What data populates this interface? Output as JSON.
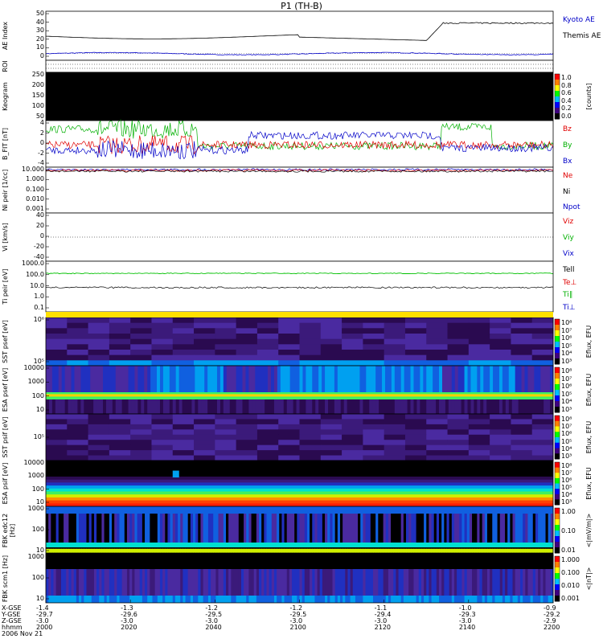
{
  "title": "P1 (TH-B)",
  "panels": [
    {
      "id": "ae",
      "ylabel": "AE Index",
      "ticks": [
        "50",
        "40",
        "30",
        "20",
        "10",
        "0"
      ],
      "legend": [
        {
          "text": "Kyoto AE",
          "color": "#0000c8"
        },
        {
          "text": "Themis AE",
          "color": "#000000"
        }
      ]
    },
    {
      "id": "roi",
      "ylabel": "ROI",
      "ticks": [],
      "legend": []
    },
    {
      "id": "keo",
      "ylabel": "Keogram",
      "ticks": [
        "250",
        "200",
        "150",
        "100",
        "50"
      ],
      "legend": [],
      "colorbar": {
        "ticks": [
          "1.0",
          "0.8",
          "0.6",
          "0.4",
          "0.2",
          "0.0"
        ],
        "label": "[counts]"
      }
    },
    {
      "id": "bfit",
      "ylabel": "B_FIT [nT]",
      "ticks": [
        "4",
        "2",
        "0",
        "-2",
        "-4"
      ],
      "legend": [
        {
          "text": "Bz",
          "color": "#e00000"
        },
        {
          "text": "By",
          "color": "#00b000"
        },
        {
          "text": "Bx",
          "color": "#0000c8"
        }
      ]
    },
    {
      "id": "ni",
      "ylabel": "Ni peir [1/cc]",
      "ticks": [
        "10.000",
        "1.000",
        "0.100",
        "0.010",
        "0.001"
      ],
      "legend": [
        {
          "text": "Ne",
          "color": "#e00000"
        },
        {
          "text": "Ni",
          "color": "#000000"
        },
        {
          "text": "Npot",
          "color": "#0000c8"
        }
      ]
    },
    {
      "id": "vi",
      "ylabel": "Vi [km/s]",
      "ticks": [
        "40",
        "20",
        "0",
        "-20",
        "-40"
      ],
      "legend": [
        {
          "text": "Viz",
          "color": "#e00000"
        },
        {
          "text": "Viy",
          "color": "#00b000"
        },
        {
          "text": "Vix",
          "color": "#0000c8"
        }
      ]
    },
    {
      "id": "ti",
      "ylabel": "Ti peir [eV]",
      "ticks": [
        "1000.0",
        "100.0",
        "10.0",
        "1.0",
        "0.1"
      ],
      "legend": [
        {
          "text": "Tell",
          "color": "#000000"
        },
        {
          "text": "Te⊥",
          "color": "#e00000"
        },
        {
          "text": "Ti∥",
          "color": "#00b000"
        },
        {
          "text": "Ti⊥",
          "color": "#0000c8"
        }
      ]
    },
    {
      "id": "sst_e",
      "ylabel": "SST psef [eV]",
      "ticks": [
        "10⁶",
        "10⁵"
      ],
      "legend": [],
      "colorbar": {
        "ticks": [
          "10⁸",
          "10⁷",
          "10⁶",
          "10⁵",
          "10⁴",
          "10³"
        ],
        "label": "Eflux, EFU"
      }
    },
    {
      "id": "esa_e",
      "ylabel": "ESA psef [eV]",
      "ticks": [
        "10000",
        "1000",
        "100",
        "10"
      ],
      "legend": [],
      "colorbar": {
        "ticks": [
          "10⁸",
          "10⁷",
          "10⁶",
          "10⁵",
          "10⁴",
          "10³"
        ],
        "label": "Eflux, EFU"
      }
    },
    {
      "id": "sst_i",
      "ylabel": "SST psif [eV]",
      "ticks": [
        "10⁵"
      ],
      "legend": [],
      "colorbar": {
        "ticks": [
          "10⁸",
          "10⁷",
          "10⁶",
          "10⁵",
          "10⁴",
          "10³"
        ],
        "label": "Eflux, EFU"
      }
    },
    {
      "id": "esa_i",
      "ylabel": "ESA psif [eV]",
      "ticks": [
        "10000",
        "1000",
        "100",
        "10"
      ],
      "legend": [],
      "colorbar": {
        "ticks": [
          "10⁸",
          "10⁷",
          "10⁶",
          "10⁵",
          "10⁴",
          "10³"
        ],
        "label": "Eflux, EFU"
      }
    },
    {
      "id": "fbk_e",
      "ylabel": "FBK edc12 [Hz]",
      "ticks": [
        "1000",
        "100",
        "10"
      ],
      "legend": [],
      "colorbar": {
        "ticks": [
          "1.00",
          "0.10",
          "0.01"
        ],
        "label": "<|mV/m|>"
      }
    },
    {
      "id": "fbk_b",
      "ylabel": "FBK scm1 [Hz]",
      "ticks": [
        "1000",
        "100",
        "10"
      ],
      "legend": [],
      "colorbar": {
        "ticks": [
          "1.000",
          "0.100",
          "0.010",
          "0.001"
        ],
        "label": "<|nT|>"
      }
    }
  ],
  "footer": {
    "rows": [
      {
        "label": "X-GSE",
        "values": [
          "-1.4",
          "-1.3",
          "-1.2",
          "-1.2",
          "-1.1",
          "-1.0",
          "-0.9"
        ]
      },
      {
        "label": "Y-GSE",
        "values": [
          "-29.7",
          "-29.6",
          "-29.5",
          "-29.5",
          "-29.4",
          "-29.3",
          "-29.2"
        ]
      },
      {
        "label": "Z-GSE",
        "values": [
          "-3.0",
          "-3.0",
          "-3.0",
          "-3.0",
          "-3.0",
          "-3.0",
          "-2.9"
        ]
      },
      {
        "label": "hhmm",
        "values": [
          "2000",
          "2020",
          "2040",
          "2100",
          "2120",
          "2140",
          "2200"
        ]
      }
    ],
    "date": "2006 Nov 21"
  },
  "chart_data": {
    "type": "line",
    "title": "P1 (TH-B)",
    "x": [
      "2000",
      "2020",
      "2040",
      "2100",
      "2120",
      "2140",
      "2200"
    ],
    "xlabel": "hhmm",
    "series": [
      {
        "name": "Kyoto AE",
        "panel": "AE Index",
        "values": [
          27,
          24,
          27,
          27,
          24,
          40,
          40
        ]
      },
      {
        "name": "Themis AE",
        "panel": "AE Index",
        "values": [
          7,
          7,
          7,
          7,
          7,
          7,
          7
        ]
      },
      {
        "name": "Ni",
        "panel": "Ni",
        "values": [
          5,
          5,
          5,
          5,
          5,
          5,
          5
        ]
      },
      {
        "name": "Tell",
        "panel": "Ti",
        "values": [
          10,
          10,
          10,
          10,
          10,
          10,
          10
        ]
      },
      {
        "name": "Ti∥",
        "panel": "Ti",
        "values": [
          150,
          150,
          150,
          150,
          150,
          150,
          150
        ]
      }
    ]
  }
}
